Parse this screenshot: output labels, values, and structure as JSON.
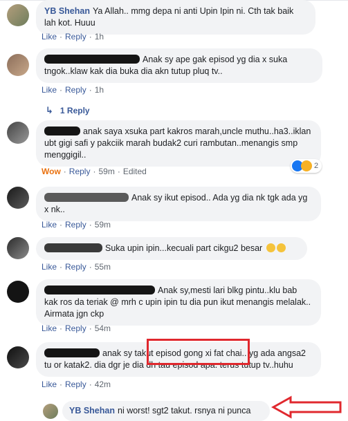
{
  "comments": [
    {
      "author": "YB Shehan",
      "text": "Ya Allah.. mmg depa ni anti Upin Ipin ni. Cth tak baik lah kot. Huuu",
      "like": "Like",
      "reply": "Reply",
      "time": "1h"
    },
    {
      "text": "Anak sy ape gak episod yg dia x suka tngok..klaw kak dia buka dia akn tutup pluq tv..",
      "like": "Like",
      "reply": "Reply",
      "time": "1h",
      "replies_link": "1 Reply"
    },
    {
      "text": "anak saya xsuka part kakros marah,uncle muthu..ha3..iklan ubt gigi safi y pakciik marah budak2 curi rambutan..menangis smp menggigil..",
      "reaction": "Wow",
      "reply": "Reply",
      "time": "59m",
      "edited": "Edited",
      "reaction_count": "2"
    },
    {
      "text": "Anak sy ikut episod.. Ada yg dia nk tgk ada yg x nk..",
      "like": "Like",
      "reply": "Reply",
      "time": "59m"
    },
    {
      "text": "Suka upin ipin...kecuali part cikgu2 besar",
      "like": "Like",
      "reply": "Reply",
      "time": "55m"
    },
    {
      "text": "Anak sy,mesti lari blkg pintu..klu bab kak ros da teriak @ mrh c upin ipin tu dia pun ikut menangis melalak.. Airmata jgn ckp",
      "like": "Like",
      "reply": "Reply",
      "time": "54m"
    },
    {
      "text_before": "anak sy takut",
      "text_highlight": "episod gong xi fat chai..",
      "text_after": "yg ada angsa2 tu or katak2. dia dgr je dia dh tau episod apa. terus tutup tv..huhu",
      "like": "Like",
      "reply": "Reply",
      "time": "42m"
    },
    {
      "author": "YB Shehan",
      "text": "ni worst! sgt2 takut. rsnya ni punca"
    }
  ],
  "colors": {
    "link": "#385898",
    "bubble": "#f2f3f5",
    "annotation": "#e0282e",
    "wow": "#e9710f"
  },
  "icons": [
    "reply-arrow-icon",
    "like-reaction-icon",
    "wow-reaction-icon",
    "smile-emoji-icon",
    "red-arrow-annotation"
  ]
}
